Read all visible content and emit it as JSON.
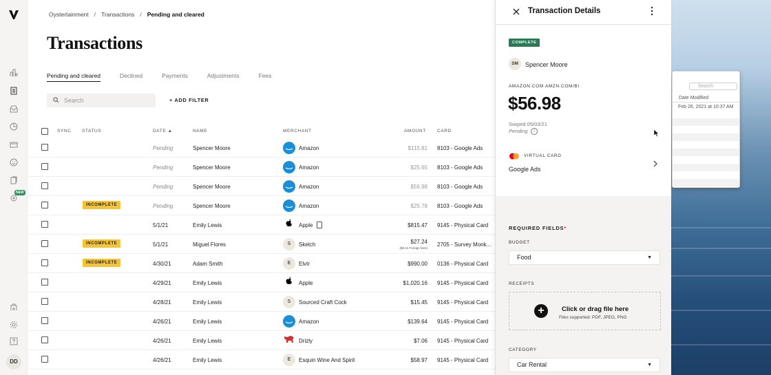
{
  "breadcrumb": {
    "org": "Oystertainment",
    "section": "Transactions",
    "current": "Pending and cleared"
  },
  "page_title": "Transactions",
  "tabs": [
    {
      "label": "Pending and cleared",
      "active": true
    },
    {
      "label": "Declined"
    },
    {
      "label": "Payments"
    },
    {
      "label": "Adjustments"
    },
    {
      "label": "Fees"
    }
  ],
  "search": {
    "placeholder": "Search"
  },
  "add_filter_label": "+ ADD FILTER",
  "columns": {
    "sync": "SYNC",
    "status": "STATUS",
    "date": "DATE ▲",
    "name": "NAME",
    "merchant": "MERCHANT",
    "amount": "AMOUNT",
    "card": "CARD"
  },
  "rows": [
    {
      "status": "",
      "date": "Pending",
      "name": "Spencer Moore",
      "merchant": "Amazon",
      "logo": "amazon",
      "amount": "$115.81",
      "card": "8103 - Google Ads"
    },
    {
      "status": "",
      "date": "Pending",
      "name": "Spencer Moore",
      "merchant": "Amazon",
      "logo": "amazon",
      "amount": "$25.65",
      "card": "8103 - Google Ads"
    },
    {
      "status": "",
      "date": "Pending",
      "name": "Spencer Moore",
      "merchant": "Amazon",
      "logo": "amazon",
      "amount": "$56.98",
      "card": "8103 - Google Ads"
    },
    {
      "status": "INCOMPLETE",
      "date": "Pending",
      "name": "Spencer Moore",
      "merchant": "Amazon",
      "logo": "amazon",
      "amount": "$25.78",
      "card": "8103 - Google Ads"
    },
    {
      "status": "",
      "date": "5/1/21",
      "name": "Emily Lewis",
      "merchant": "Apple",
      "logo": "apple",
      "amount": "$815.47",
      "card": "9145 - Physical Card"
    },
    {
      "status": "INCOMPLETE",
      "date": "5/1/21",
      "name": "Miguel Flores",
      "merchant": "Sketch",
      "logo": "S",
      "amount": "$27.24",
      "fee": "($0.24 Foreign fees)",
      "card": "2705 - Survey Monk..."
    },
    {
      "status": "INCOMPLETE",
      "date": "4/30/21",
      "name": "Adam Smith",
      "merchant": "Elvtr",
      "logo": "E",
      "amount": "$990.00",
      "card": "0136 - Physical Card"
    },
    {
      "status": "",
      "date": "4/29/21",
      "name": "Emily Lewis",
      "merchant": "Apple",
      "logo": "apple",
      "amount": "$1,020.16",
      "card": "9145 - Physical Card"
    },
    {
      "status": "",
      "date": "4/28/21",
      "name": "Emily Lewis",
      "merchant": "Sourced Craft Cock",
      "logo": "S",
      "amount": "$15.45",
      "card": "9145 - Physical Card"
    },
    {
      "status": "",
      "date": "4/26/21",
      "name": "Emily Lewis",
      "merchant": "Amazon",
      "logo": "amazon",
      "amount": "$139.64",
      "card": "9145 - Physical Card"
    },
    {
      "status": "",
      "date": "4/26/21",
      "name": "Emily Lewis",
      "merchant": "Drizly",
      "logo": "drizly",
      "amount": "$7.06",
      "card": "9145 - Physical Card"
    },
    {
      "status": "",
      "date": "4/26/21",
      "name": "Emily Lewis",
      "merchant": "Esquin Wine And Spirit",
      "logo": "E",
      "amount": "$58.97",
      "card": "9145 - Physical Card"
    }
  ],
  "sidebar": {
    "new_badge": "NEW",
    "user_initials": "DD"
  },
  "panel": {
    "title": "Transaction Details",
    "status": "COMPLETE",
    "user_initials": "SM",
    "user_name": "Spencer Moore",
    "merchant_descriptor": "AMAZON.COM AMZN.COM/BI",
    "amount": "$56.98",
    "swiped": "Swiped 05/03/21",
    "state": "Pending",
    "card_label": "VIRTUAL CARD",
    "card_name": "Google Ads",
    "required_fields": "REQUIRED FIELDS",
    "budget_label": "BUDGET",
    "budget_value": "Food",
    "receipts_label": "RECEIPTS",
    "dropzone_title": "Click or drag file here",
    "dropzone_sub": "Files supported: PDF, JPEG, PNG",
    "category_label": "CATEGORY",
    "category_value": "Car Rental"
  },
  "finder": {
    "search_placeholder": "Search",
    "column": "Date Modified",
    "date": "Feb 26, 2021 at 10:37 AM"
  },
  "colors": {
    "incomplete": "#f4c437",
    "complete": "#2b7a55",
    "amazon": "#1a8fd8",
    "required": "#d0312d"
  }
}
